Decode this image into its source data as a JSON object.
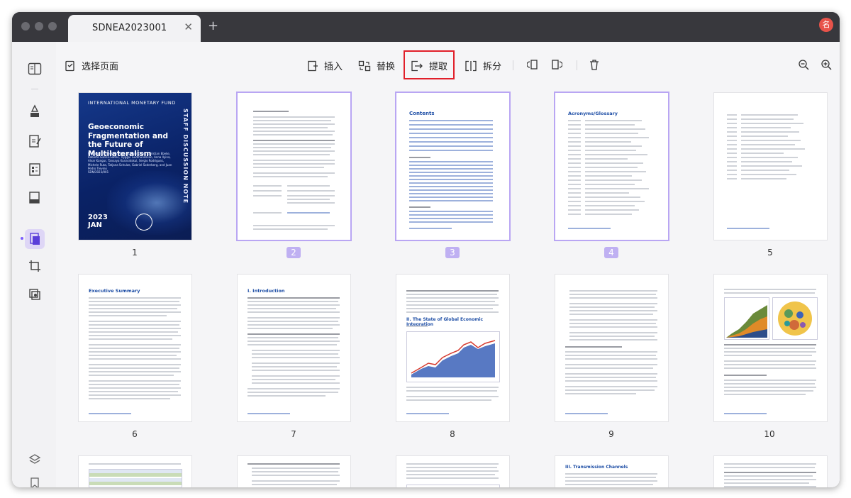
{
  "tab": {
    "title": "SDNEA2023001"
  },
  "avatar": {
    "letter": "名"
  },
  "toolbar": {
    "select_pages": "选择页面",
    "insert": "插入",
    "replace": "替换",
    "extract": "提取",
    "split": "拆分"
  },
  "pages": [
    {
      "label": "1",
      "selected": false
    },
    {
      "label": "2",
      "selected": true
    },
    {
      "label": "3",
      "selected": true
    },
    {
      "label": "4",
      "selected": true
    },
    {
      "label": "5",
      "selected": false
    },
    {
      "label": "6",
      "selected": false
    },
    {
      "label": "7",
      "selected": false
    },
    {
      "label": "8",
      "selected": false
    },
    {
      "label": "9",
      "selected": false
    },
    {
      "label": "10",
      "selected": false
    }
  ],
  "cover": {
    "org": "INTERNATIONAL MONETARY FUND",
    "title": "Geoeconomic Fragmentation and the Future of Multilateralism",
    "authors": "Prepared by Shekhar Aiyar, Jiaqian Chen, Christian Ebeke, Roberto Garcia-Saltos, Tryggvi Gudmundsson, Anna Ilyina, Alvar Kangur, Tansaya Kunaratskul, Sergio Rodriguez, Michele Ruta, Tatjana Schulze, Gabriel Soderberg, and Juan Pedro Trevino",
    "code": "SDN/2023/001",
    "side": "STAFF DISCUSSION NOTE",
    "year": "2023",
    "month": "JAN"
  },
  "page_headings": {
    "p3": "Contents",
    "p4": "Acronyms/Glossary",
    "p6": "Executive Summary",
    "p7": "I. Introduction",
    "p8": "II. The State of Global Economic Integration",
    "p13": "III. Transmission Channels"
  }
}
